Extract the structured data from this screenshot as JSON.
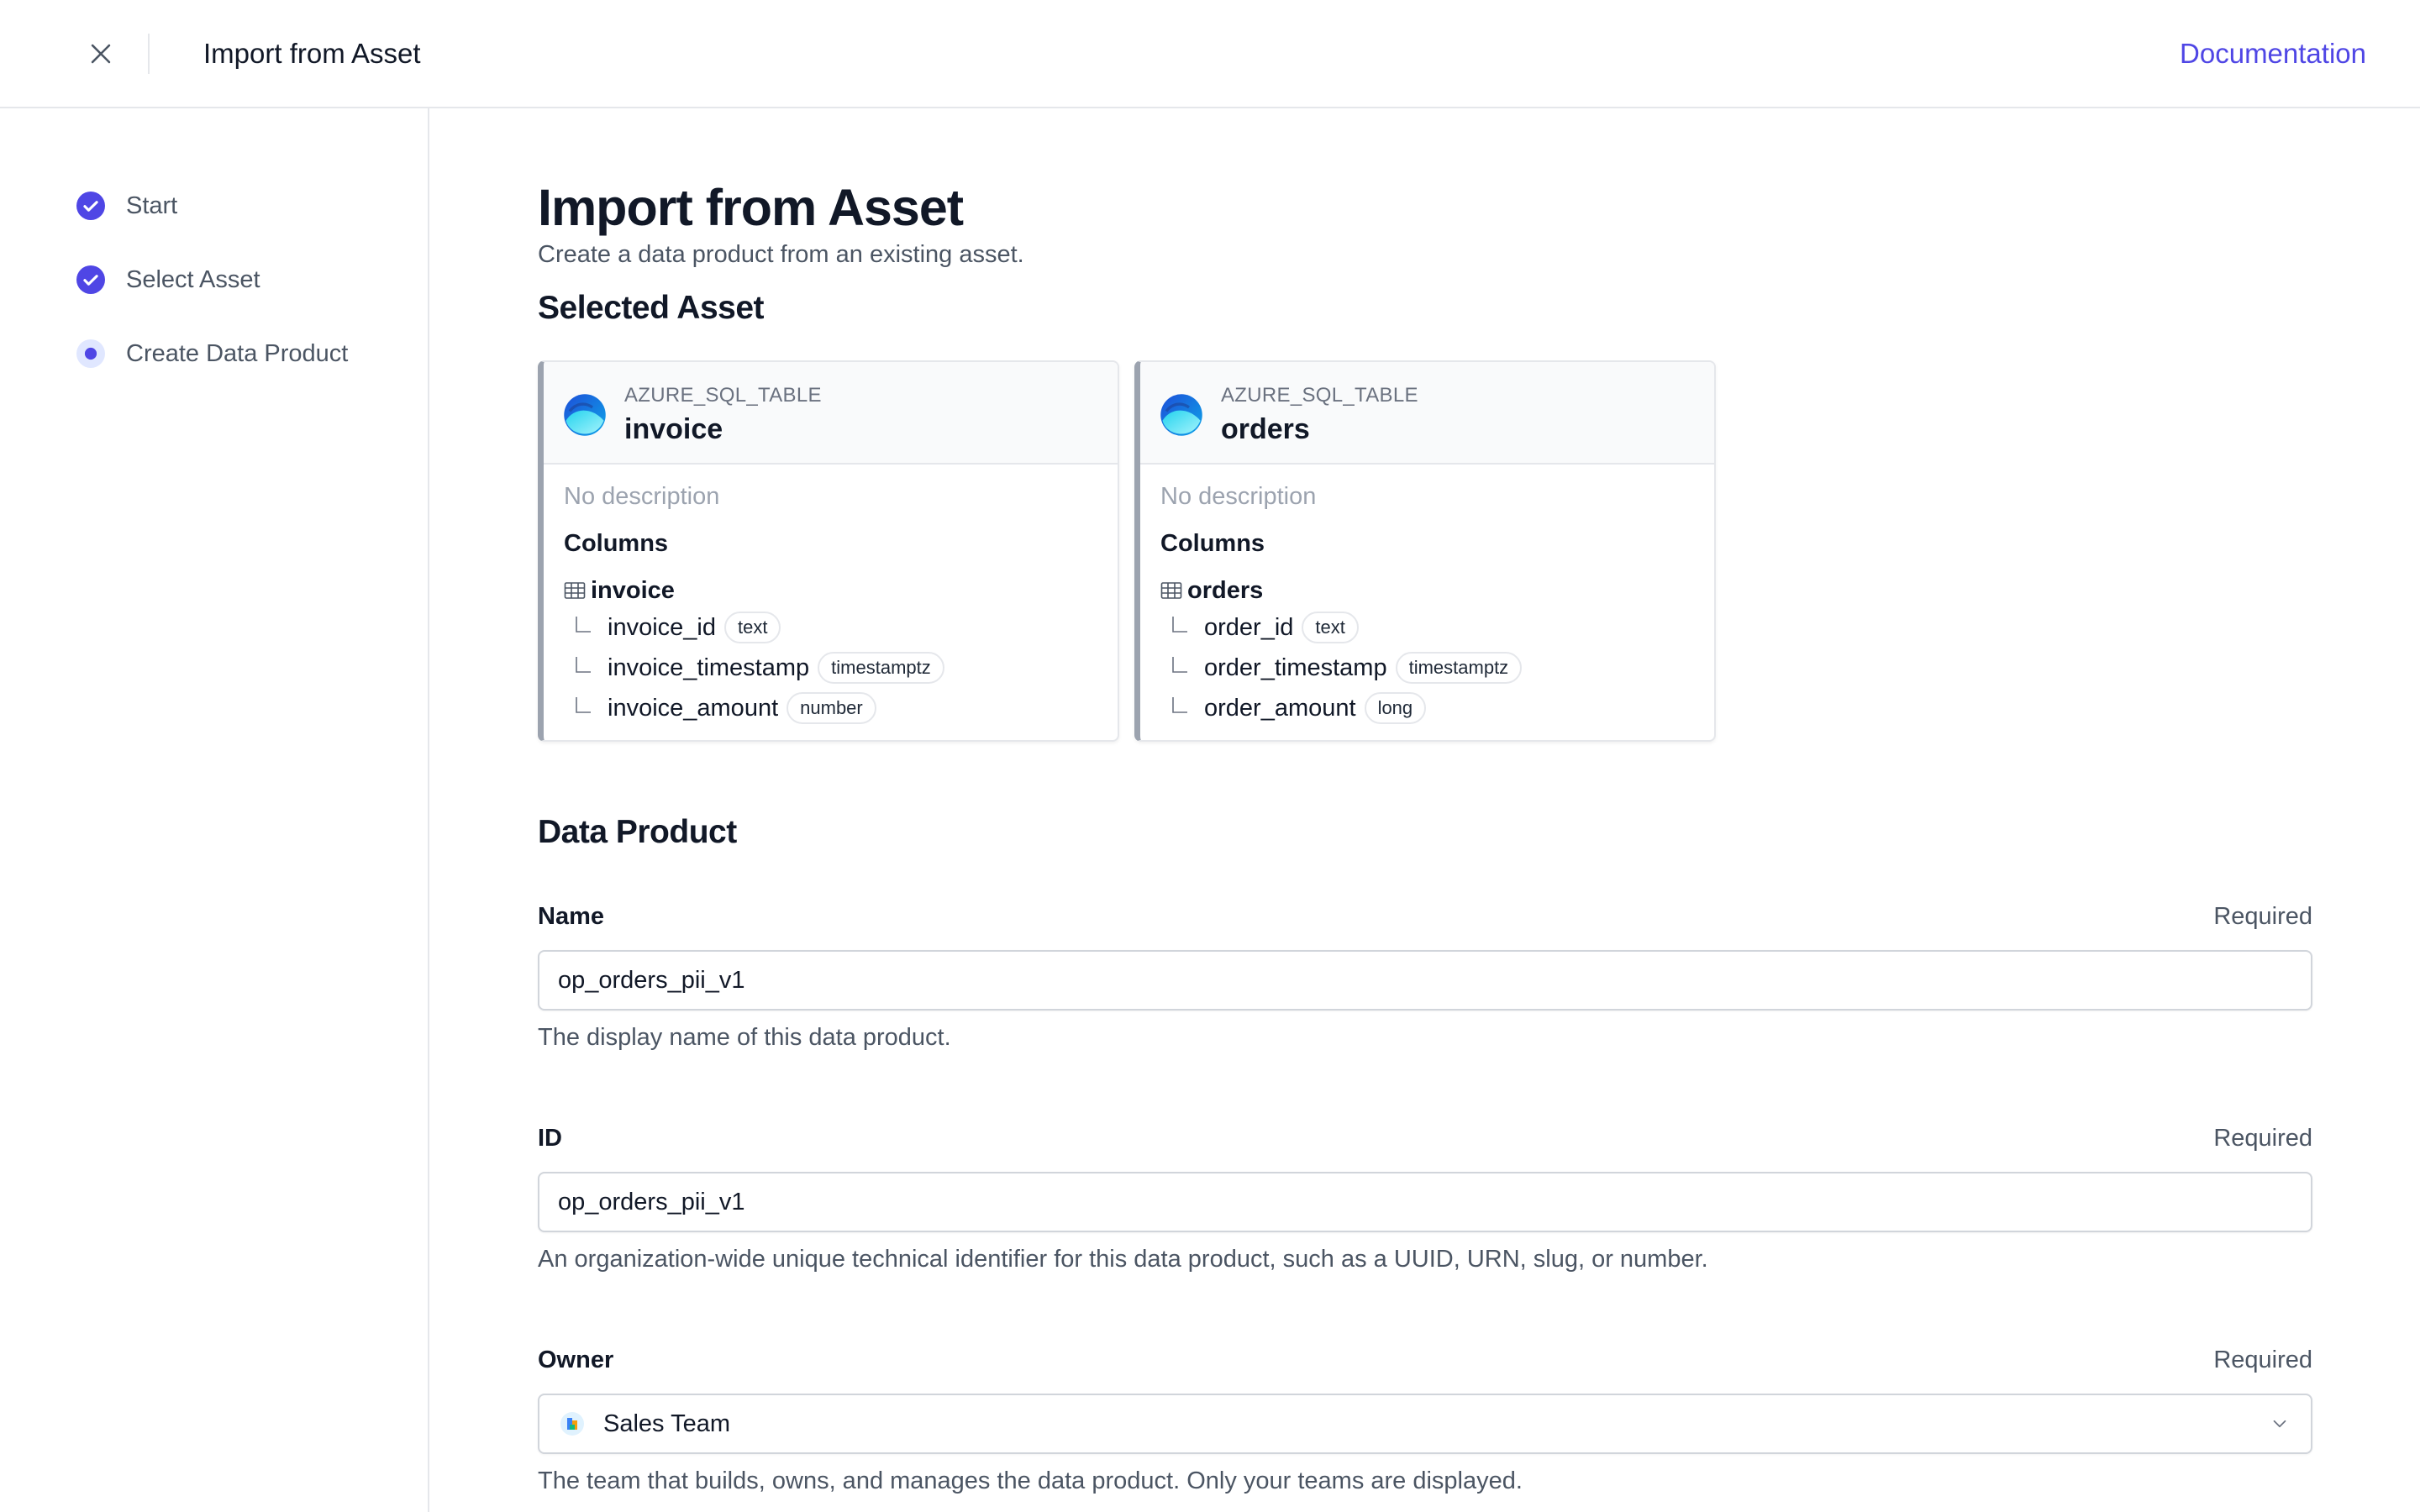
{
  "header": {
    "title": "Import from Asset",
    "documentation_label": "Documentation"
  },
  "sidebar": {
    "steps": [
      {
        "label": "Start",
        "state": "complete"
      },
      {
        "label": "Select Asset",
        "state": "complete"
      },
      {
        "label": "Create Data Product",
        "state": "current"
      }
    ]
  },
  "main": {
    "title": "Import from Asset",
    "subtitle": "Create a data product from an existing asset.",
    "selected_asset_heading": "Selected Asset",
    "assets": [
      {
        "type": "AZURE_SQL_TABLE",
        "name": "invoice",
        "description": "No description",
        "columns_heading": "Columns",
        "table": "invoice",
        "columns": [
          {
            "name": "invoice_id",
            "type": "text"
          },
          {
            "name": "invoice_timestamp",
            "type": "timestamptz"
          },
          {
            "name": "invoice_amount",
            "type": "number"
          }
        ]
      },
      {
        "type": "AZURE_SQL_TABLE",
        "name": "orders",
        "description": "No description",
        "columns_heading": "Columns",
        "table": "orders",
        "columns": [
          {
            "name": "order_id",
            "type": "text"
          },
          {
            "name": "order_timestamp",
            "type": "timestamptz"
          },
          {
            "name": "order_amount",
            "type": "long"
          }
        ]
      }
    ],
    "data_product_heading": "Data Product",
    "form": {
      "name": {
        "label": "Name",
        "required": "Required",
        "value": "op_orders_pii_v1",
        "help": "The display name of this data product."
      },
      "id": {
        "label": "ID",
        "required": "Required",
        "value": "op_orders_pii_v1",
        "help": "An organization-wide unique technical identifier for this data product, such as a UUID, URN, slug, or number."
      },
      "owner": {
        "label": "Owner",
        "required": "Required",
        "value": "Sales Team",
        "help": "The team that builds, owns, and manages the data product. Only your teams are displayed."
      }
    }
  },
  "colors": {
    "accent": "#4f46e5",
    "text": "#111827",
    "muted": "#4b5563",
    "border": "#e5e7eb"
  },
  "icons": {
    "close": "close-icon",
    "step_complete": "check-circle-icon",
    "step_current": "dot-circle-icon",
    "asset": "azure-sql-icon",
    "table": "table-icon",
    "column": "branch-icon",
    "select": "chevron-down-icon"
  }
}
